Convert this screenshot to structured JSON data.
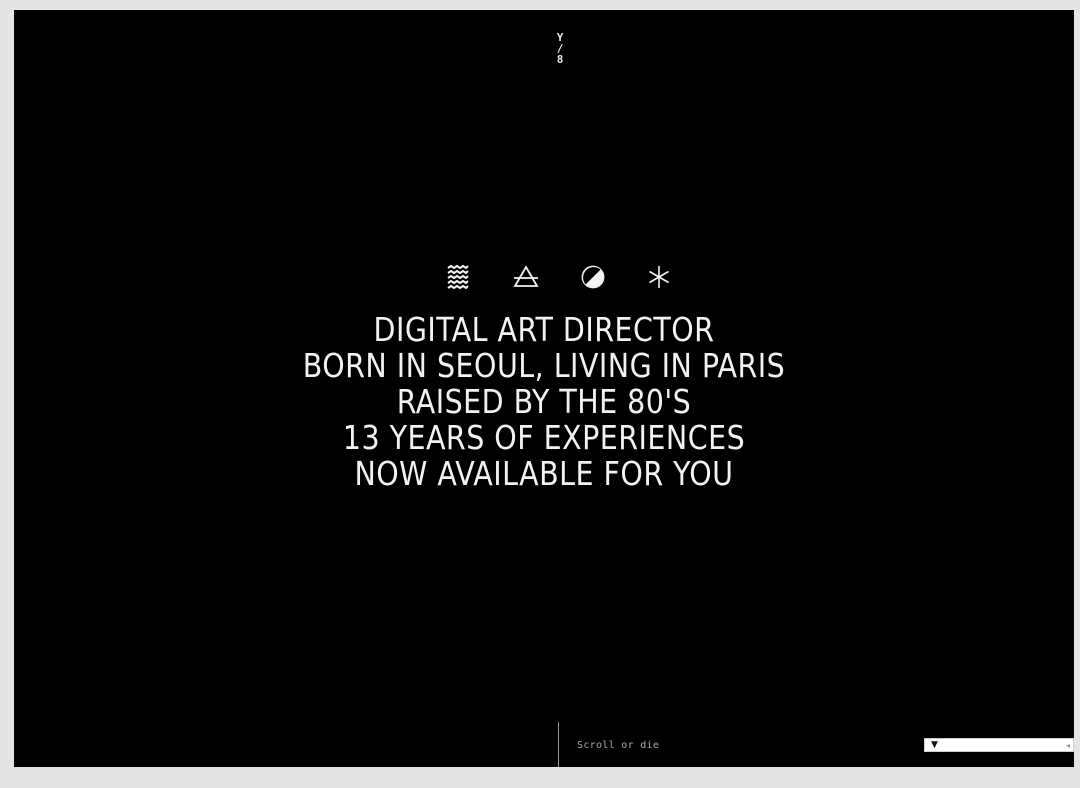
{
  "logo": {
    "chars": [
      "Y",
      "/",
      "8"
    ]
  },
  "icons": [
    {
      "name": "water-icon"
    },
    {
      "name": "air-icon"
    },
    {
      "name": "half-moon-icon"
    },
    {
      "name": "asterisk-icon"
    }
  ],
  "headline": {
    "lines": [
      "DIGITAL ART DIRECTOR",
      "BORN IN SEOUL, LIVING IN PARIS",
      "RAISED BY THE 80'S",
      "13 YEARS OF EXPERIENCES",
      "NOW AVAILABLE FOR YOU"
    ]
  },
  "footer": {
    "scroll_text": "Scroll or die"
  },
  "player": {
    "play_label": "▼"
  },
  "colors": {
    "background": "#000000",
    "text": "#f2f2f2",
    "page": "#e3e4e6"
  }
}
